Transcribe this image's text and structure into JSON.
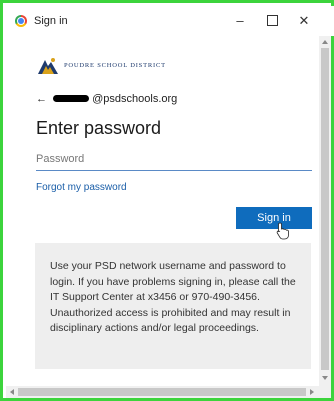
{
  "window": {
    "title": "Sign in",
    "minimize_glyph": "–",
    "close_glyph": "✕",
    "icon": "chrome-icon"
  },
  "logo": {
    "text": "POUDRE SCHOOL DISTRICT"
  },
  "account": {
    "back_glyph": "←",
    "email_suffix": "@psdschools.org"
  },
  "form": {
    "title": "Enter password",
    "password_placeholder": "Password",
    "password_value": "",
    "forgot_link": "Forgot my password",
    "signin_label": "Sign in"
  },
  "notice": {
    "text": "Use your PSD network username and password to login. If you have problems signing in, please call the IT Support Center at x3456 or 970-490-3456. Unauthorized access is prohibited and may result in disciplinary actions and/or legal proceedings."
  },
  "colors": {
    "frame_border": "#3cd43c",
    "accent": "#0f6cbd",
    "link": "#1a5ea8",
    "notice_bg": "#eeeeee"
  }
}
